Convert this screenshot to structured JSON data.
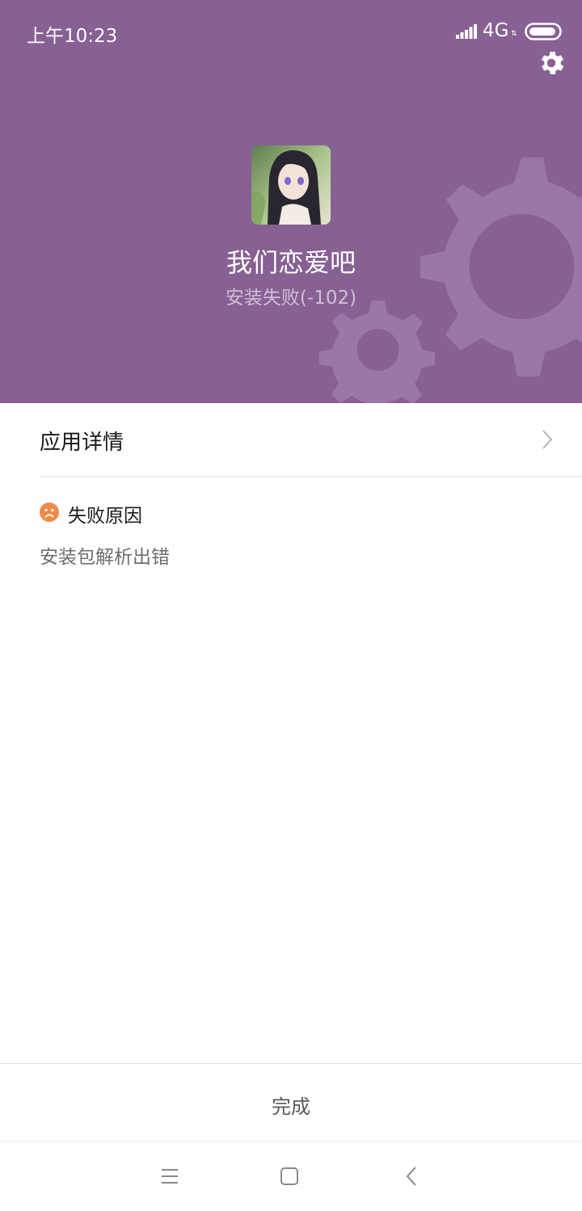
{
  "status_bar": {
    "time": "上午10:23",
    "network": "4G",
    "network_arrows": "⇅",
    "icons": [
      "signal-icon",
      "battery-icon"
    ]
  },
  "header": {
    "settings_icon": "gear-icon",
    "background_color": "#876094",
    "app_icon": "app-icon",
    "app_name": "我们恋爱吧",
    "install_status": "安装失败(-102)"
  },
  "details": {
    "label": "应用详情",
    "icon": "chevron-right-icon"
  },
  "failure": {
    "icon": "sad-face-icon",
    "icon_color": "#f08a4b",
    "title": "失败原因",
    "reason": "安装包解析出错"
  },
  "footer": {
    "done_label": "完成"
  },
  "nav_bar": {
    "icons": [
      "menu-icon",
      "home-icon",
      "back-icon"
    ]
  }
}
